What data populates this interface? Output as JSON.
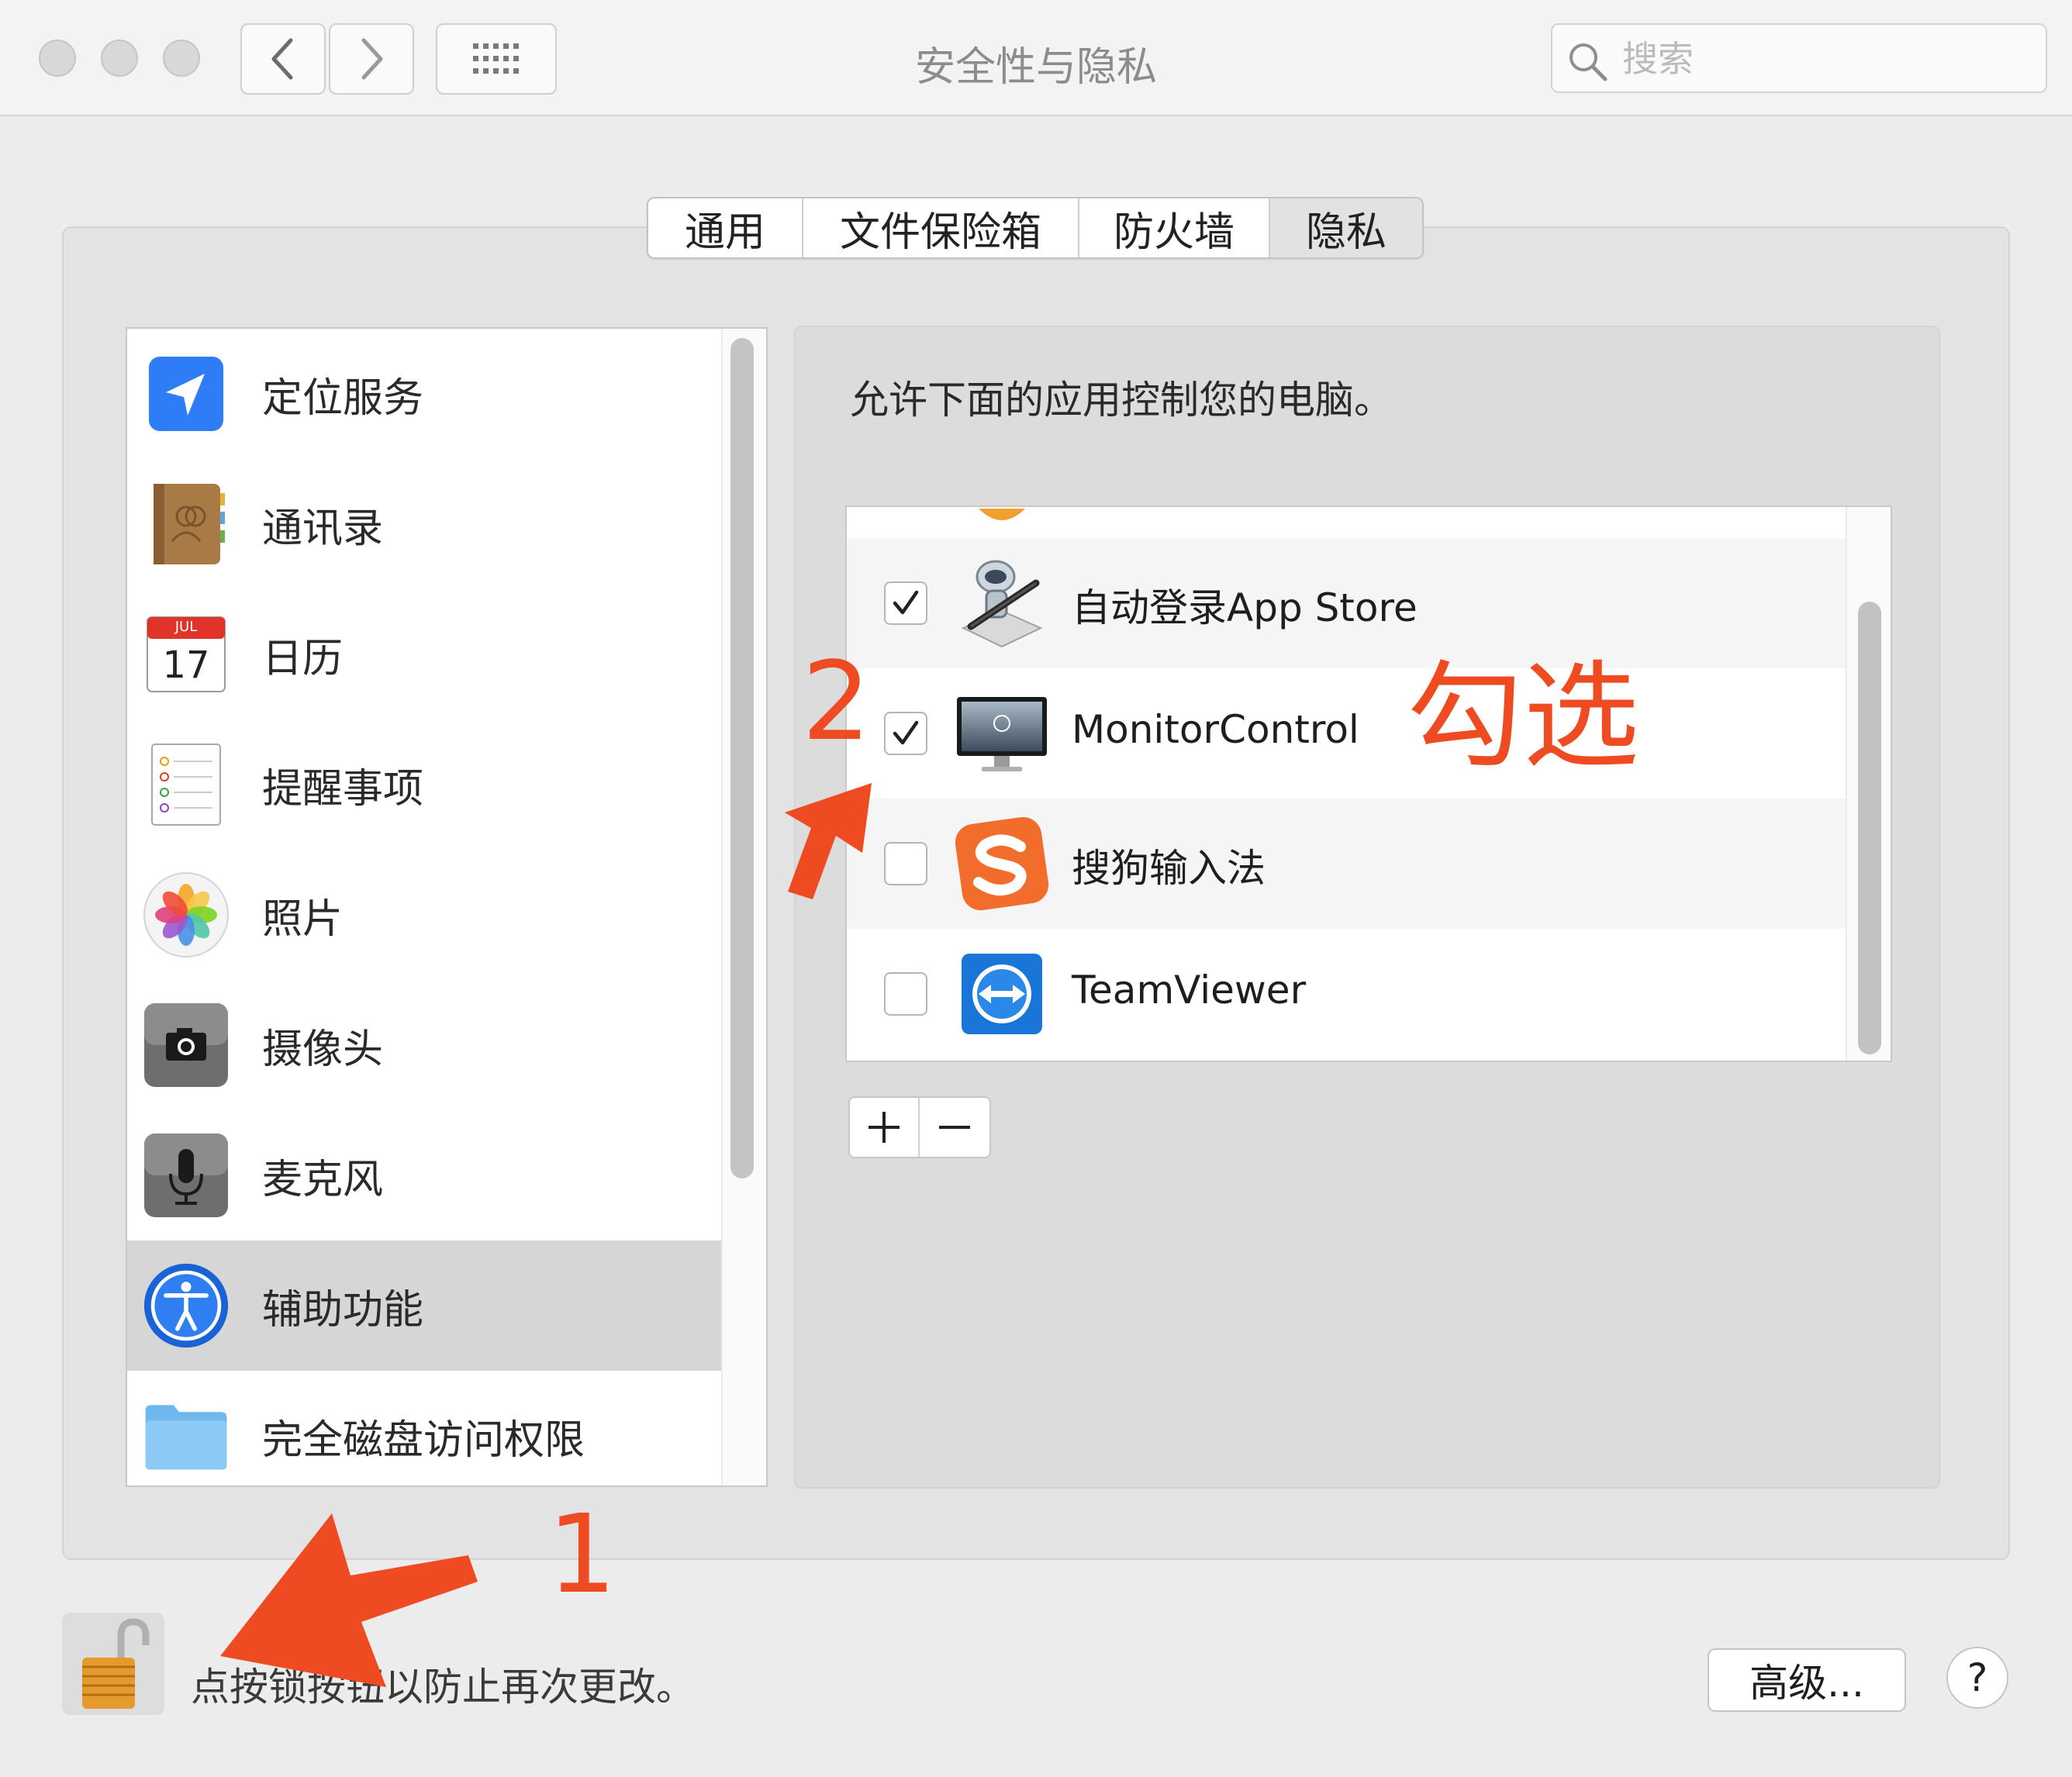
{
  "window": {
    "title": "安全性与隐私",
    "search_placeholder": "搜索"
  },
  "tabs": [
    {
      "label": "通用",
      "selected": false
    },
    {
      "label": "文件保险箱",
      "selected": false
    },
    {
      "label": "防火墙",
      "selected": false
    },
    {
      "label": "隐私",
      "selected": true
    }
  ],
  "sidebar": {
    "items": [
      {
        "label": "定位服务",
        "icon": "location-arrow-icon"
      },
      {
        "label": "通讯录",
        "icon": "contacts-book-icon"
      },
      {
        "label": "日历",
        "icon": "calendar-icon",
        "badge_month": "JUL",
        "badge_day": "17"
      },
      {
        "label": "提醒事项",
        "icon": "reminders-icon"
      },
      {
        "label": "照片",
        "icon": "photos-flower-icon"
      },
      {
        "label": "摄像头",
        "icon": "camera-icon"
      },
      {
        "label": "麦克风",
        "icon": "microphone-icon"
      },
      {
        "label": "辅助功能",
        "icon": "accessibility-icon",
        "selected": true
      },
      {
        "label": "完全磁盘访问权限",
        "icon": "folder-icon"
      }
    ]
  },
  "right": {
    "heading": "允许下面的应用控制您的电脑。",
    "apps": [
      {
        "name": "自动登录App Store",
        "checked": true,
        "icon": "automator-robot-icon"
      },
      {
        "name": "MonitorControl",
        "checked": true,
        "icon": "monitor-display-icon"
      },
      {
        "name": "搜狗输入法",
        "checked": false,
        "icon": "sogou-s-icon"
      },
      {
        "name": "TeamViewer",
        "checked": false,
        "icon": "teamviewer-arrows-icon"
      }
    ]
  },
  "bottom": {
    "lock_text": "点按锁按钮以防止再次更改。",
    "advanced_label": "高级...",
    "help_label": "?"
  },
  "annotations": {
    "step1": "1",
    "step2": "2",
    "check_note": "勾选",
    "color": "#ee4b22"
  },
  "colors": {
    "accent_blue": "#2e7cf6",
    "annotation_orange": "#ee4b22"
  }
}
